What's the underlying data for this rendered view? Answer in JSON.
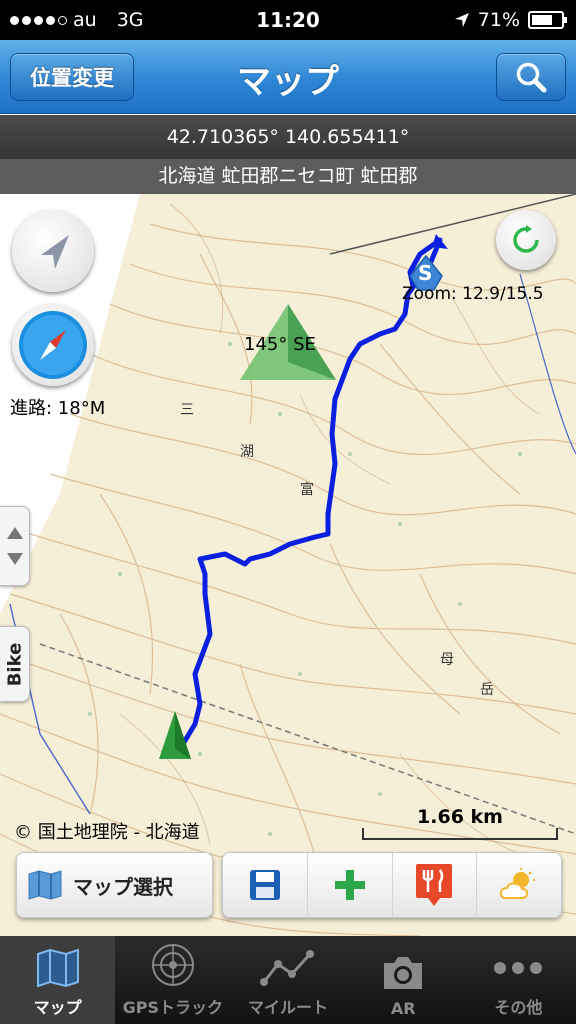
{
  "status_bar": {
    "carrier": "au",
    "network": "3G",
    "time": "11:20",
    "battery": "71%",
    "battery_level": 0.71
  },
  "nav": {
    "title": "マップ",
    "left_button": "位置変更",
    "right_icon": "search-icon"
  },
  "coords": "42.710365° 140.655411°",
  "address": "北海道 虻田郡ニセコ町 虻田郡",
  "map": {
    "zoom": "Zoom: 12.9/15.5",
    "heading": "145° SE",
    "course": "進路: 18°M",
    "copyright": "© 国土地理院 - 北海道",
    "scale": "1.66 km",
    "side_tab": "Bike",
    "start_marker": "S",
    "route_color": "#0a1fe0"
  },
  "toolbar": {
    "map_select": "マップ選択",
    "icons": [
      "save-icon",
      "add-icon",
      "restaurant-icon",
      "weather-icon"
    ]
  },
  "tabs": [
    {
      "label": "マップ",
      "icon": "map-icon",
      "active": true
    },
    {
      "label": "GPSトラック",
      "icon": "radar-icon",
      "active": false
    },
    {
      "label": "マイルート",
      "icon": "route-icon",
      "active": false
    },
    {
      "label": "AR",
      "icon": "camera-icon",
      "active": false
    },
    {
      "label": "その他",
      "icon": "more-icon",
      "active": false
    }
  ]
}
